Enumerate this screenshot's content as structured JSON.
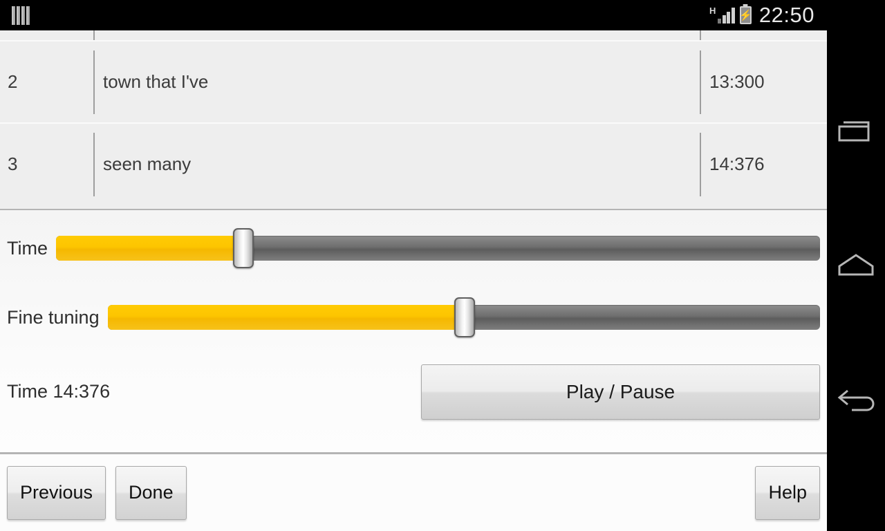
{
  "status_bar": {
    "left_icon": "sim-card-icon",
    "network_type": "H",
    "signal_icon": "signal-bars-icon",
    "battery_icon": "battery-charging-icon",
    "battery_glyph": "⚡",
    "clock": "22:50"
  },
  "table": {
    "rows": [
      {
        "index": "",
        "text": "",
        "time": "",
        "partial": true
      },
      {
        "index": "2",
        "text": "town that I've",
        "time": "13:300",
        "partial": false
      },
      {
        "index": "3",
        "text": "seen many",
        "time": "14:376",
        "partial": false
      }
    ]
  },
  "controls": {
    "time_slider": {
      "label": "Time",
      "fill_percent": 24.5,
      "thumb_percent": 24.5
    },
    "fine_tuning_slider": {
      "label": "Fine tuning",
      "fill_percent": 50.1,
      "thumb_percent": 50.1
    },
    "time_readout": "Time 14:376",
    "play_pause_label": "Play / Pause"
  },
  "bottom_bar": {
    "previous_label": "Previous",
    "done_label": "Done",
    "help_label": "Help"
  },
  "navbar": {
    "recents": "recents-icon",
    "home": "home-icon",
    "back": "back-icon"
  },
  "colors": {
    "accent": "#fdc500",
    "track": "#6e6e6e",
    "table_row": "#eeeeee",
    "panel": "#fafafa"
  }
}
